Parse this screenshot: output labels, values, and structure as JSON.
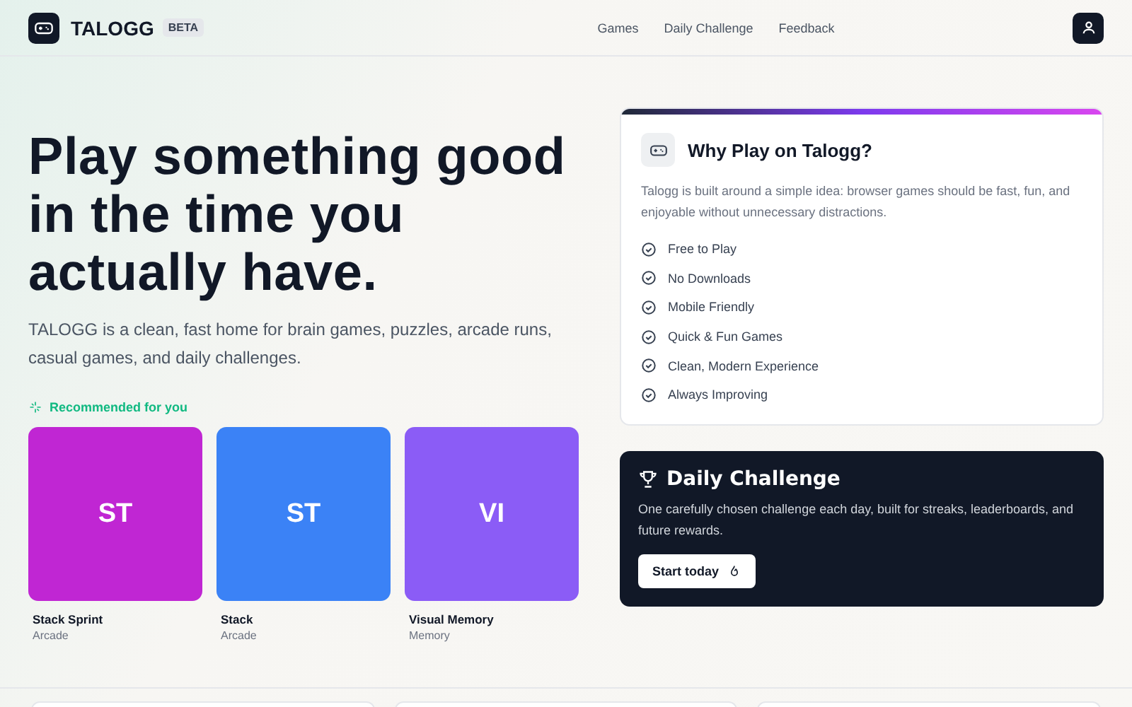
{
  "header": {
    "brand": "TALOGG",
    "badge": "BETA",
    "nav": [
      {
        "label": "Games"
      },
      {
        "label": "Daily Challenge"
      },
      {
        "label": "Feedback"
      }
    ]
  },
  "hero": {
    "headline": "Play something good in the time you actually have.",
    "intro": "TALOGG is a clean, fast home for brain games, puzzles, arcade runs, casual games, and daily challenges.",
    "recommended_label": "Recommended for you",
    "games": [
      {
        "initials": "ST",
        "name": "Stack Sprint",
        "category": "Arcade",
        "color": "#c026d3"
      },
      {
        "initials": "ST",
        "name": "Stack",
        "category": "Arcade",
        "color": "#3b82f6"
      },
      {
        "initials": "VI",
        "name": "Visual Memory",
        "category": "Memory",
        "color": "#8b5cf6"
      }
    ]
  },
  "why_card": {
    "title": "Why Play on Talogg?",
    "description": "Talogg is built around a simple idea: browser games should be fast, fun, and enjoyable without unnecessary distractions.",
    "features": [
      "Free to Play",
      "No Downloads",
      "Mobile Friendly",
      "Quick & Fun Games",
      "Clean, Modern Experience",
      "Always Improving"
    ]
  },
  "daily_challenge": {
    "title": "Daily Challenge",
    "description": "One carefully chosen challenge each day, built for streaks, leaderboards, and future rewards.",
    "button": "Start today"
  }
}
